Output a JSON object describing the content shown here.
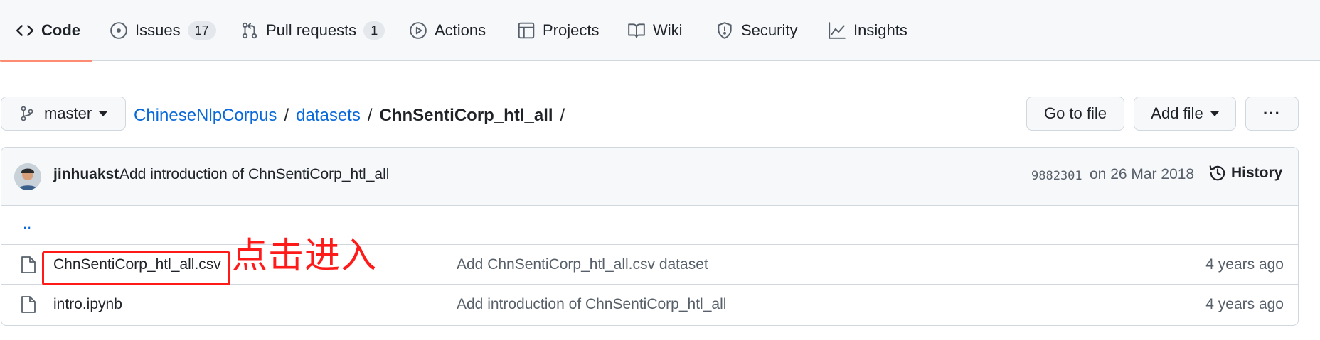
{
  "tabs": [
    {
      "label": "Code",
      "icon": "code-icon",
      "active": true
    },
    {
      "label": "Issues",
      "icon": "issue-icon",
      "count": "17"
    },
    {
      "label": "Pull requests",
      "icon": "pull-request-icon",
      "count": "1"
    },
    {
      "label": "Actions",
      "icon": "play-icon"
    },
    {
      "label": "Projects",
      "icon": "table-icon"
    },
    {
      "label": "Wiki",
      "icon": "book-icon"
    },
    {
      "label": "Security",
      "icon": "shield-icon"
    },
    {
      "label": "Insights",
      "icon": "graph-icon"
    }
  ],
  "branch": {
    "name": "master",
    "icon": "git-branch-icon"
  },
  "breadcrumb": {
    "repo": "ChineseNlpCorpus",
    "folder": "datasets",
    "current": "ChnSentiCorp_htl_all",
    "separator": "/"
  },
  "actions": {
    "go_to_file": "Go to file",
    "add_file": "Add file",
    "more": "···"
  },
  "commit": {
    "author": "jinhuakst",
    "message": "Add introduction of ChnSentiCorp_htl_all",
    "sha": "9882301",
    "date": "on 26 Mar 2018",
    "history_label": "History"
  },
  "files": {
    "parent": "..",
    "rows": [
      {
        "name": "ChnSentiCorp_htl_all.csv",
        "message": "Add ChnSentiCorp_htl_all.csv dataset",
        "age": "4 years ago"
      },
      {
        "name": "intro.ipynb",
        "message": "Add introduction of ChnSentiCorp_htl_all",
        "age": "4 years ago"
      }
    ]
  },
  "annotation": {
    "text": "点击进入",
    "color": "#ff1a1a"
  },
  "colors": {
    "accent": "#fd8c73",
    "link": "#0969da",
    "border": "#d0d7de"
  }
}
